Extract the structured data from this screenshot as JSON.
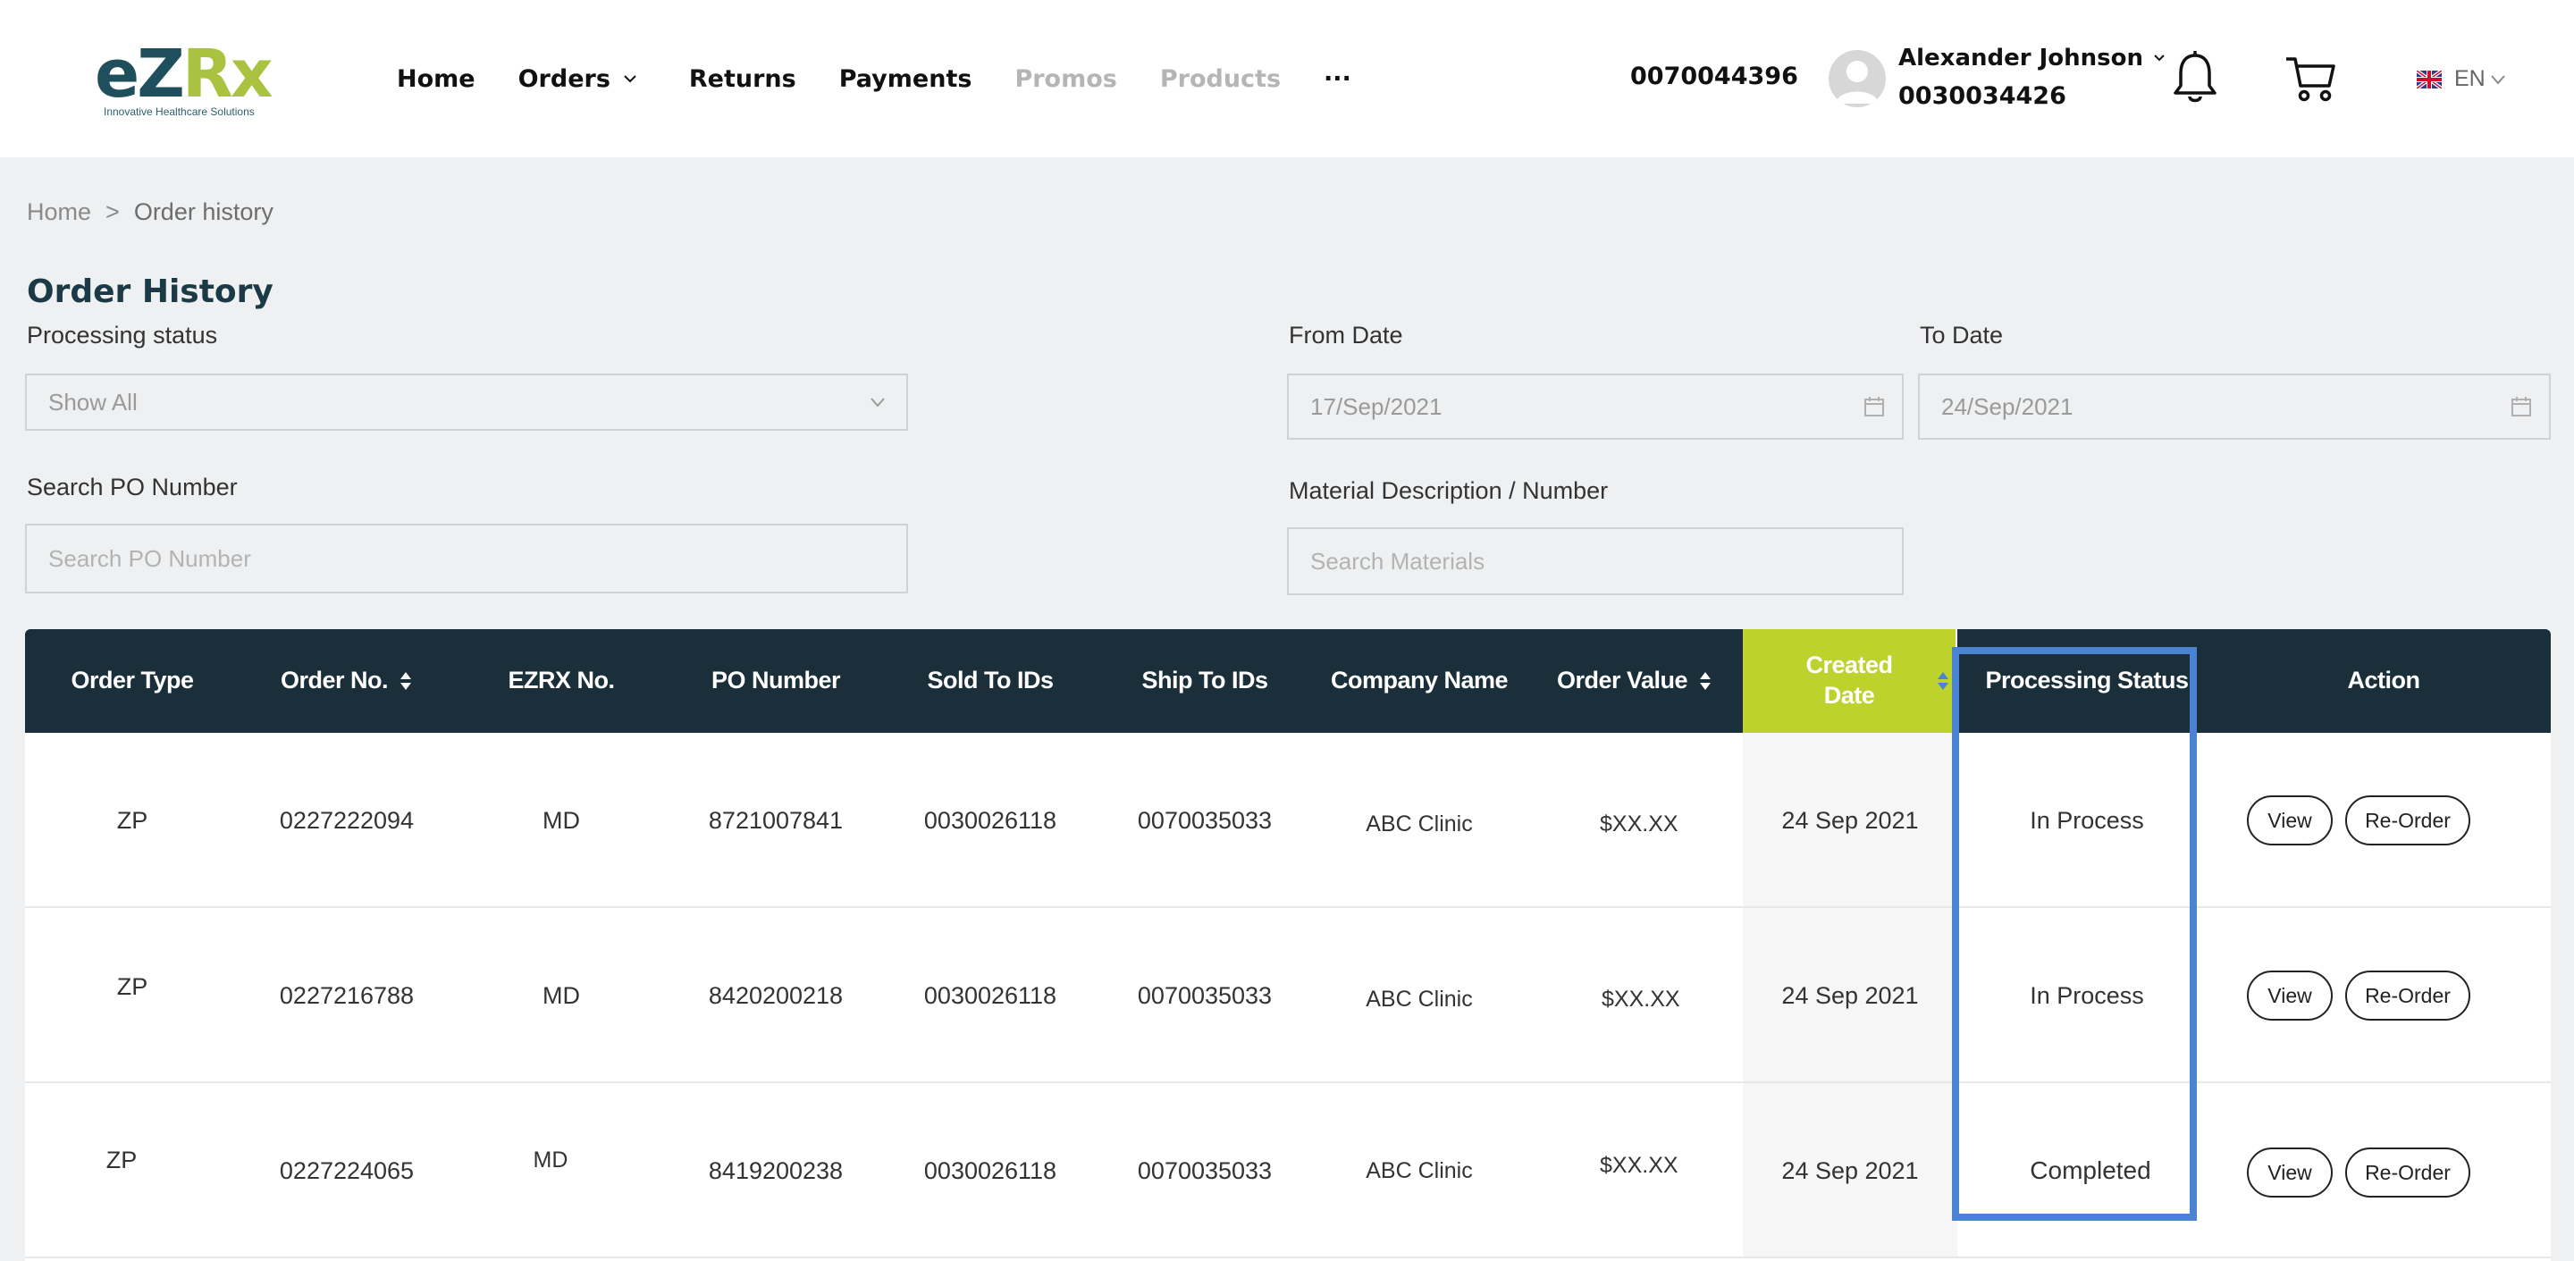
{
  "brand": {
    "logo_e": "e",
    "logo_z": "Z",
    "logo_rx": "Rx",
    "tagline": "Innovative Healthcare Solutions"
  },
  "nav": {
    "home": "Home",
    "orders": "Orders",
    "returns": "Returns",
    "payments": "Payments",
    "promos": "Promos",
    "products": "Products",
    "more": "···"
  },
  "account": {
    "number": "0070044396",
    "user_name": "Alexander Johnson",
    "user_id": "0030034426"
  },
  "language": {
    "code": "EN"
  },
  "breadcrumb": {
    "home": "Home",
    "separator": ">",
    "current": "Order history"
  },
  "page": {
    "title": "Order History"
  },
  "filters": {
    "processing_status_label": "Processing status",
    "processing_status_value": "Show All",
    "from_date_label": "From Date",
    "from_date_value": "17/Sep/2021",
    "to_date_label": "To Date",
    "to_date_value": "24/Sep/2021",
    "po_label": "Search PO Number",
    "po_placeholder": "Search PO Number",
    "material_label": "Material Description / Number",
    "material_placeholder": "Search Materials"
  },
  "table": {
    "headers": {
      "order_type": "Order Type",
      "order_no": "Order No.",
      "ezrx_no": "EZRX No.",
      "po_number": "PO Number",
      "sold_to": "Sold To IDs",
      "ship_to": "Ship To IDs",
      "company": "Company Name",
      "order_value": "Order Value",
      "created_line1": "Created",
      "created_line2": "Date",
      "status": "Processing Status",
      "action": "Action"
    },
    "rows": [
      {
        "order_type": "ZP",
        "order_no": "0227222094",
        "ezrx_no": "MD",
        "po_number": "8721007841",
        "sold_to": "0030026118",
        "ship_to": "0070035033",
        "company": "ABC Clinic",
        "order_value": "$XX.XX",
        "created": "24 Sep 2021",
        "status": "In Process",
        "view": "View",
        "reorder": "Re-Order"
      },
      {
        "order_type": "ZP",
        "order_no": "0227216788",
        "ezrx_no": "MD",
        "po_number": "8420200218",
        "sold_to": "0030026118",
        "ship_to": "0070035033",
        "company": "ABC Clinic",
        "order_value": "$XX.XX",
        "created": "24 Sep 2021",
        "status": "In Process",
        "view": "View",
        "reorder": "Re-Order"
      },
      {
        "order_type": "ZP",
        "order_no": "0227224065",
        "ezrx_no": "MD",
        "po_number": "8419200238",
        "sold_to": "0030026118",
        "ship_to": "0070035033",
        "company": "ABC Clinic",
        "order_value": "$XX.XX",
        "created": "24 Sep 2021",
        "status": "Completed",
        "view": "View",
        "reorder": "Re-Order"
      }
    ]
  },
  "colors": {
    "header_dark": "#1b2f3a",
    "accent_green": "#bdd22c",
    "highlight_blue": "#4a82d4",
    "brand_teal": "#1f4f5c",
    "brand_lime": "#a9c23f"
  }
}
